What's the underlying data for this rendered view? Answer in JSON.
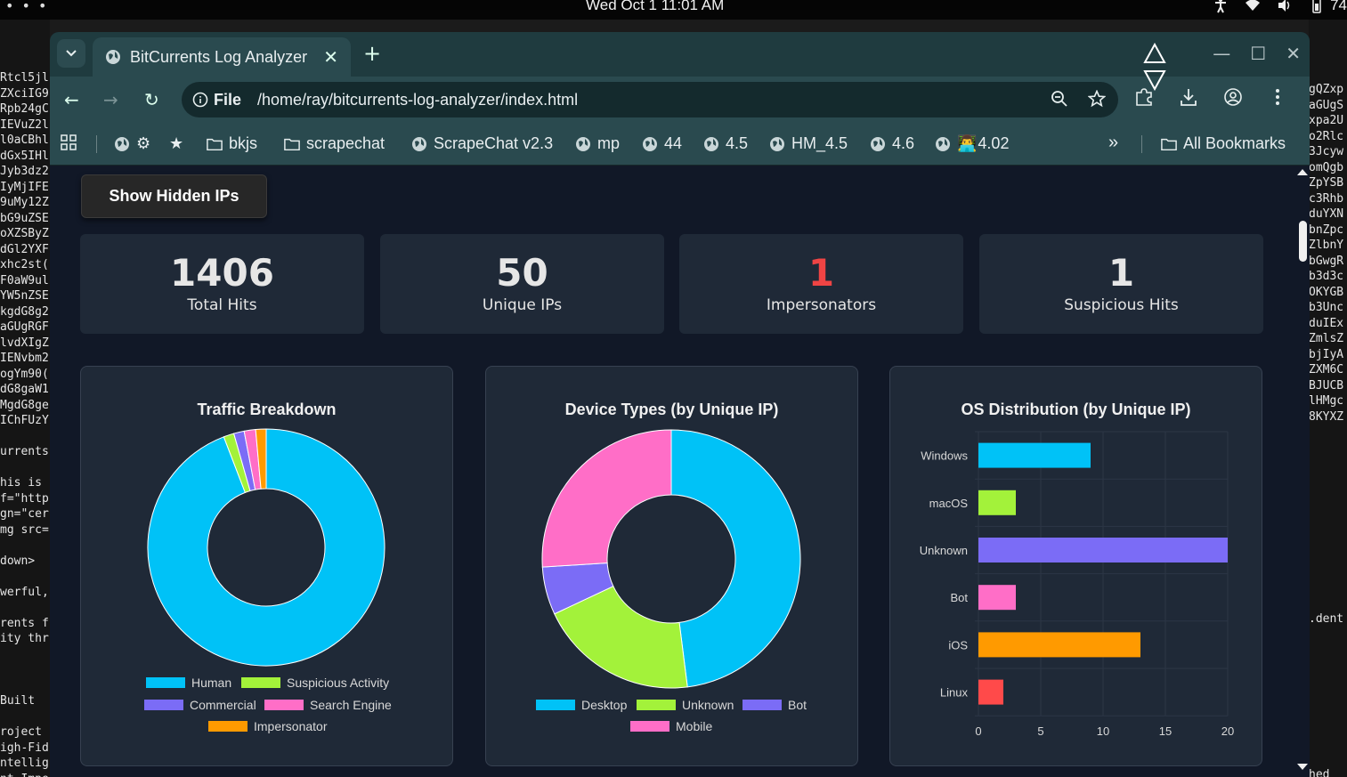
{
  "os": {
    "clock": "Wed Oct 1  11:01 AM",
    "battery": "74"
  },
  "terminal_left": [
    "Rtcl5jl",
    "ZXciIG9",
    "Rpb24gC",
    "IEVuZ2l",
    "l0aCBhl",
    "dGx5IHl",
    "Jyb3dz2",
    "IyMjIFE",
    "9uMy12Z",
    "bG9uZSE",
    "oXZSByZ",
    "dGl2YXF",
    "xhc2st(",
    "F0aW9ul",
    "YW5nZSE",
    "kgdG8g2",
    "aGUgRGF",
    "lvdXIgZ",
    "IENvbm2",
    "ogYm90(",
    "dG8gaW1",
    "MgdG8ge",
    "IChFUzY",
    "",
    "urrents",
    "",
    "his is ",
    "f=\"http",
    "gn=\"cer",
    "mg src=",
    "",
    "down>",
    "",
    "werful,",
    "",
    "rents f",
    "ity thr",
    "",
    "",
    "",
    "Built",
    "",
    "roject",
    "igh-Fid",
    "ntellig",
    "nt Impe"
  ],
  "terminal_right": [
    "gQZxp",
    "aGUgS",
    "xpa2U",
    "o2Rlc",
    "3Jcyw",
    "omQgb",
    "ZpYSB",
    "c3Rhb",
    "duYXN",
    "bnZpc",
    "ZlbnY",
    "bGwgR",
    "b3d3c",
    "OKYGB",
    "b3Unc",
    "duIEx",
    "ZmlsZ",
    "bjIyA",
    "ZXM6C",
    "BJUCB",
    "lHMgc",
    "8KYXZ",
    "",
    "",
    "",
    "",
    "",
    "",
    "",
    "",
    "",
    "",
    "",
    "",
    ".dent",
    "",
    "",
    "",
    "",
    "",
    "",
    "",
    "",
    "",
    "hed"
  ],
  "browser": {
    "tab_title": "BitCurrents Log Analyzer",
    "url_chip": "File",
    "url": "/home/ray/bitcurrents-log-analyzer/index.html"
  },
  "bookmarks": {
    "items": [
      "bkjs",
      "scrapechat",
      "ScrapeChat v2.3",
      "mp",
      "44",
      "4.5",
      "HM_4.5",
      "4.6",
      "4.02"
    ],
    "emoji_prefix": "👨‍💻",
    "more": "»",
    "all": "All Bookmarks"
  },
  "page": {
    "hidden_ips_button": "Show Hidden IPs",
    "stats": [
      {
        "value": "1406",
        "label": "Total Hits",
        "color": "#e6e6e6"
      },
      {
        "value": "50",
        "label": "Unique IPs",
        "color": "#e6e6e6"
      },
      {
        "value": "1",
        "label": "Impersonators",
        "color": "#ef4444"
      },
      {
        "value": "1",
        "label": "Suspicious Hits",
        "color": "#e6e6e6"
      }
    ]
  },
  "chart_data": [
    {
      "type": "pie",
      "title": "Traffic Breakdown",
      "categories": [
        "Human",
        "Suspicious Activity",
        "Commercial",
        "Search Engine",
        "Impersonator"
      ],
      "values": [
        1324,
        20,
        20,
        22,
        20
      ],
      "colors": [
        "#00c2f7",
        "#a3f23a",
        "#7b6cf6",
        "#ff6ec7",
        "#ff9a00"
      ],
      "legend": "bottom"
    },
    {
      "type": "pie",
      "title": "Device Types (by Unique IP)",
      "categories": [
        "Desktop",
        "Unknown",
        "Bot",
        "Mobile"
      ],
      "values": [
        24,
        10,
        3,
        13
      ],
      "colors": [
        "#00c2f7",
        "#a3f23a",
        "#7b6cf6",
        "#ff6ec7"
      ],
      "legend": "bottom"
    },
    {
      "type": "bar",
      "orientation": "horizontal",
      "title": "OS Distribution (by Unique IP)",
      "categories": [
        "Windows",
        "macOS",
        "Unknown",
        "Bot",
        "iOS",
        "Linux"
      ],
      "values": [
        9,
        3,
        20,
        3,
        13,
        2
      ],
      "colors": [
        "#00c2f7",
        "#a3f23a",
        "#7b6cf6",
        "#ff6ec7",
        "#ff9a00",
        "#ff4a4a"
      ],
      "xlim": [
        0,
        20
      ],
      "xticks": [
        "0",
        "5",
        "10",
        "15",
        "20"
      ],
      "grid": true
    }
  ]
}
